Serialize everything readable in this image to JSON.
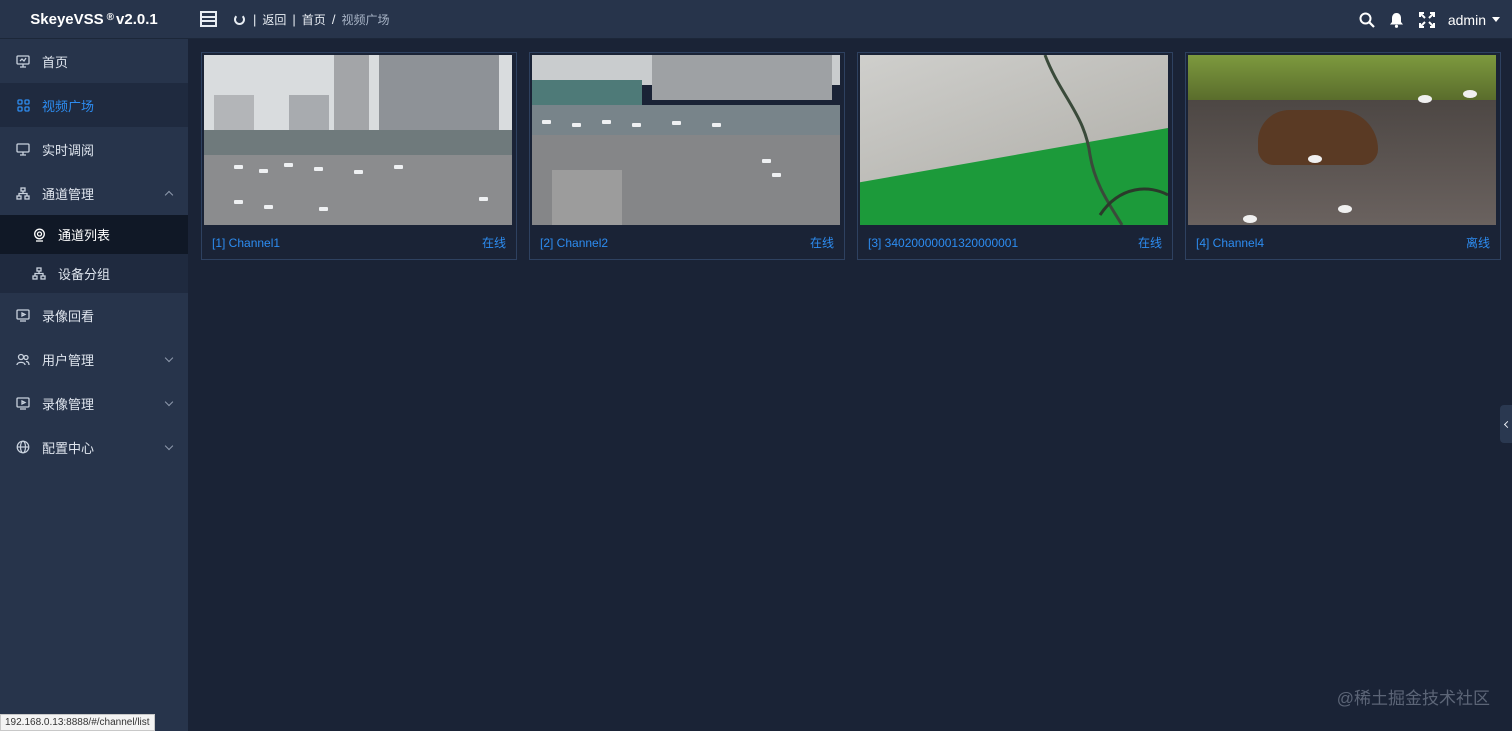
{
  "app": {
    "name": "SkeyeVSS",
    "reg": "®",
    "version": "v2.0.1"
  },
  "header": {
    "back_label": "返回",
    "breadcrumb": [
      "首页",
      "视频广场"
    ],
    "breadcrumb_sep": "/",
    "username": "admin",
    "icons": [
      "search-icon",
      "bell-icon",
      "fullscreen-icon"
    ]
  },
  "sidebar": {
    "items": [
      {
        "label": "首页",
        "icon": "monitor-icon"
      },
      {
        "label": "视频广场",
        "icon": "grid-icon"
      },
      {
        "label": "实时调阅",
        "icon": "screen-icon"
      },
      {
        "label": "通道管理",
        "icon": "sitemap-icon"
      },
      {
        "label": "录像回看",
        "icon": "play-screen-icon"
      },
      {
        "label": "用户管理",
        "icon": "users-icon"
      },
      {
        "label": "录像管理",
        "icon": "video-box-icon"
      },
      {
        "label": "配置中心",
        "icon": "globe-icon"
      }
    ],
    "sub_items": [
      {
        "label": "通道列表",
        "icon": "camera-icon"
      },
      {
        "label": "设备分组",
        "icon": "group-icon"
      }
    ]
  },
  "channels": [
    {
      "name": "[1] Channel1",
      "status": "在线"
    },
    {
      "name": "[2] Channel2",
      "status": "在线"
    },
    {
      "name": "[3] 34020000001320000001",
      "status": "在线"
    },
    {
      "name": "[4] Channel4",
      "status": "离线"
    }
  ],
  "colors": {
    "accent": "#2d8cf0",
    "sidebar": "#27344b",
    "content": "#1a2336"
  },
  "watermark": "@稀土掘金技术社区",
  "status_url": "192.168.0.13:8888/#/channel/list"
}
